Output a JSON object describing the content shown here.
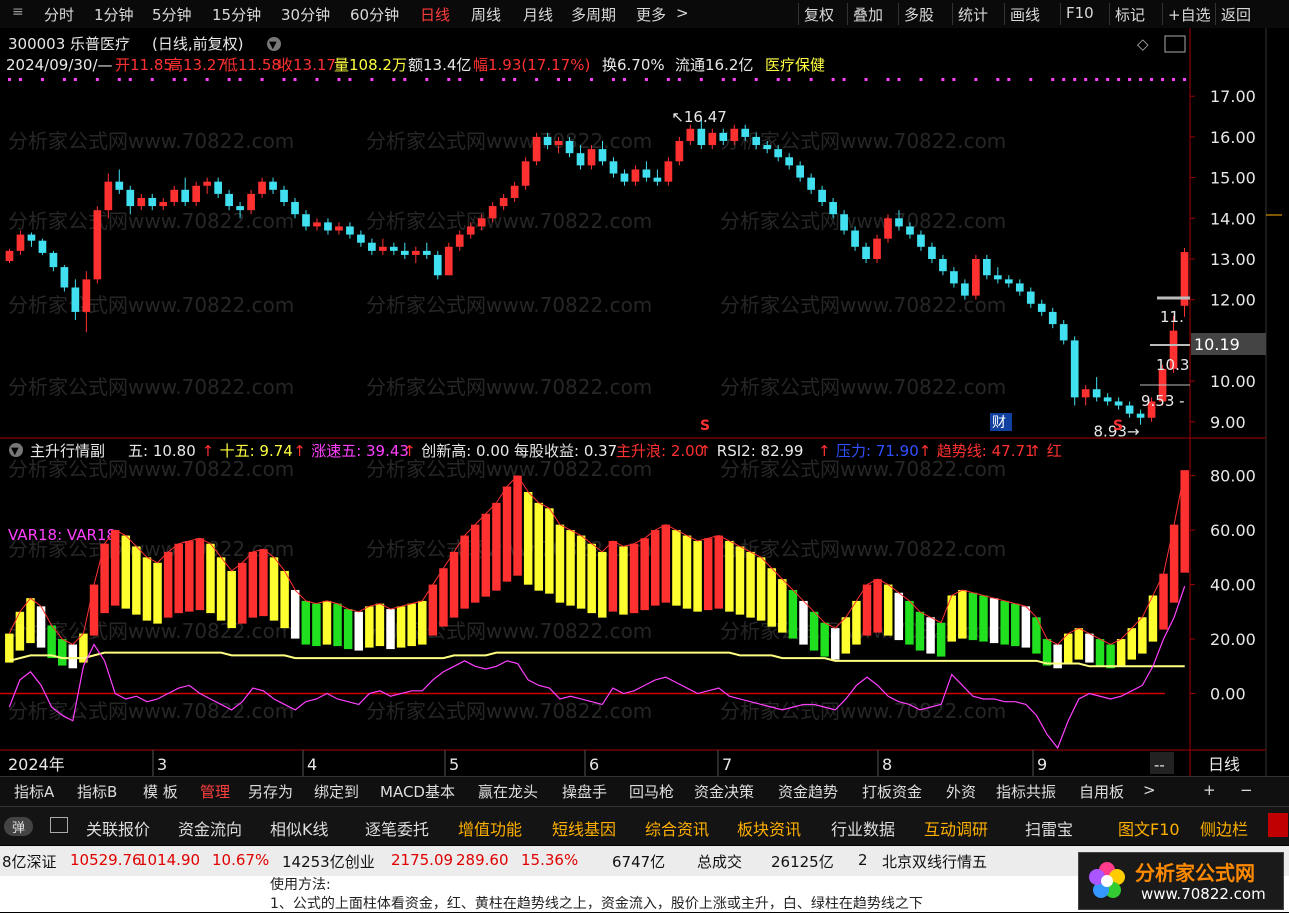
{
  "toolbar": {
    "periods": [
      "分时",
      "1分钟",
      "5分钟",
      "15分钟",
      "30分钟",
      "60分钟",
      "日线",
      "周线",
      "月线",
      "多周期",
      "更多"
    ],
    "active_period": "日线",
    "right_buttons": [
      "复权",
      "叠加",
      "多股",
      "统计",
      "画线",
      "F10",
      "标记",
      "+自选",
      "返回"
    ]
  },
  "stock": {
    "code_name": "300003 乐普医疗",
    "period_tag": "(日线,前复权)",
    "date": "2024/09/30/—",
    "open": "开11.85",
    "high": "高13.27",
    "low": "低11.58",
    "close": "收13.17",
    "volume": "量108.2万",
    "amount": "额13.4亿",
    "change": "幅1.93(17.17%)",
    "turnover": "换6.70%",
    "float_cap": "流通16.2亿",
    "sector": "医疗保健"
  },
  "watermark": "分析家公式网www.70822.com",
  "price_axis": [
    "17.00",
    "16.00",
    "15.00",
    "14.00",
    "13.00",
    "12.00",
    "11.00",
    "10.00",
    "9.00"
  ],
  "price_tags": {
    "last": "10.19",
    "box1": "11.",
    "box2": "10.3",
    "box3": "9.53 -"
  },
  "annotations": {
    "high": "16.47",
    "low": "8.93",
    "cai": "财",
    "s": "S"
  },
  "indicator": {
    "name": "主升行情副",
    "items": [
      {
        "label": "五: 10.80",
        "arrow": "↑",
        "color": "#e8e8e8"
      },
      {
        "label": "十五: 9.74",
        "arrow": "↑",
        "color": "#ffff40"
      },
      {
        "label": "涨速五: 39.43",
        "arrow": "↑",
        "color": "#ff40ff"
      },
      {
        "label": "创新高: 0.00",
        "arrow": "",
        "color": "#e8e8e8"
      },
      {
        "label": "每股收益: 0.37",
        "arrow": "",
        "color": "#e8e8e8"
      },
      {
        "label": "主升浪: 2.00",
        "arrow": "↑",
        "color": "#ff3030"
      },
      {
        "label": "RSI2: 82.99",
        "arrow": "↑",
        "color": "#e8e8e8"
      },
      {
        "label": "压力: 71.90",
        "arrow": "↑",
        "color": "#3050ff"
      },
      {
        "label": "趋势线: 47.71",
        "arrow": "↑",
        "color": "#ff3030"
      },
      {
        "label": "红",
        "arrow": "",
        "color": "#ff3030"
      }
    ],
    "var_label": "VAR18: VAR18"
  },
  "ind_axis": [
    "80.00",
    "60.00",
    "40.00",
    "20.00",
    "0.00"
  ],
  "xaxis": {
    "year": "2024年",
    "months": [
      "3",
      "4",
      "5",
      "6",
      "7",
      "8",
      "9"
    ],
    "period": "日线",
    "dash": "--"
  },
  "bottom_tabs": [
    "指标A",
    "指标B",
    "模 板",
    "管理",
    "另存为",
    "绑定到",
    "MACD基本",
    "赢在龙头",
    "操盘手",
    "回马枪",
    "资金决策",
    "资金趋势",
    "打板资金",
    "外资",
    "指标共振",
    "自用板"
  ],
  "bottom_tab_selected": "管理",
  "bottom_controls": {
    "more": ">",
    "plus": "+",
    "minus": "−"
  },
  "func_buttons": [
    {
      "label": "关联报价",
      "style": "normal"
    },
    {
      "label": "资金流向",
      "style": "normal"
    },
    {
      "label": "相似K线",
      "style": "normal"
    },
    {
      "label": "逐笔委托",
      "style": "normal"
    },
    {
      "label": "增值功能",
      "style": "orange"
    },
    {
      "label": "短线基因",
      "style": "orange"
    },
    {
      "label": "综合资讯",
      "style": "orange"
    },
    {
      "label": "板块资讯",
      "style": "orange"
    },
    {
      "label": "行业数据",
      "style": "normal"
    },
    {
      "label": "互动调研",
      "style": "orange"
    },
    {
      "label": "扫雷宝",
      "style": "normal"
    },
    {
      "label": "图文F10",
      "style": "orange"
    },
    {
      "label": "侧边栏",
      "style": "orange"
    }
  ],
  "pop_label": "弹",
  "ticker": [
    {
      "text": "8亿深证",
      "style": "normal"
    },
    {
      "text": "10529.76",
      "style": "red"
    },
    {
      "text": "1014.90",
      "style": "red"
    },
    {
      "text": "10.67%",
      "style": "red"
    },
    {
      "text": "14253亿创业",
      "style": "normal"
    },
    {
      "text": "2175.09",
      "style": "red"
    },
    {
      "text": "289.60",
      "style": "red"
    },
    {
      "text": "15.36%",
      "style": "red"
    },
    {
      "text": "6747亿",
      "style": "normal"
    },
    {
      "text": "总成交",
      "style": "normal"
    },
    {
      "text": "26125亿",
      "style": "normal"
    },
    {
      "text": "2",
      "style": "normal"
    },
    {
      "text": "北京双线行情五",
      "style": "normal"
    }
  ],
  "note_lines": [
    "使用方法:",
    "1、公式的上面柱体看资金，红、黄柱在趋势线之上，资金流入，股价上涨或主升，白、绿柱在趋势线之下"
  ],
  "logo": {
    "title": "分析家公式网",
    "url": "www.70822.com"
  },
  "colors": {
    "up": "#ff3030",
    "down": "#40e0f0",
    "yellow": "#ffff30",
    "green": "#20e020",
    "magenta": "#ff40ff",
    "axis": "#a00000"
  },
  "chart_data": [
    {
      "type": "candlestick",
      "title": "300003 乐普医疗 (日线,前复权)",
      "x_labels": [
        "2024年",
        "3",
        "4",
        "5",
        "6",
        "7",
        "8",
        "9"
      ],
      "ylim": [
        8.7,
        17.3
      ],
      "candles": [
        [
          12.95,
          13.25,
          12.9,
          13.2
        ],
        [
          13.2,
          13.7,
          13.1,
          13.6
        ],
        [
          13.6,
          13.65,
          13.3,
          13.45
        ],
        [
          13.45,
          13.5,
          13.1,
          13.15
        ],
        [
          13.15,
          13.2,
          12.7,
          12.8
        ],
        [
          12.8,
          12.85,
          12.2,
          12.3
        ],
        [
          12.3,
          12.5,
          11.5,
          11.7
        ],
        [
          11.7,
          12.7,
          11.2,
          12.5
        ],
        [
          12.5,
          14.3,
          12.4,
          14.2
        ],
        [
          14.2,
          15.1,
          14.0,
          14.9
        ],
        [
          14.9,
          15.2,
          14.6,
          14.7
        ],
        [
          14.7,
          14.8,
          14.1,
          14.3
        ],
        [
          14.3,
          14.6,
          14.2,
          14.5
        ],
        [
          14.5,
          14.6,
          14.2,
          14.3
        ],
        [
          14.3,
          14.5,
          14.2,
          14.4
        ],
        [
          14.4,
          14.8,
          14.3,
          14.7
        ],
        [
          14.7,
          15.0,
          14.3,
          14.4
        ],
        [
          14.4,
          14.9,
          14.3,
          14.8
        ],
        [
          14.8,
          15.0,
          14.6,
          14.9
        ],
        [
          14.9,
          15.0,
          14.5,
          14.6
        ],
        [
          14.6,
          14.7,
          14.2,
          14.3
        ],
        [
          14.3,
          14.4,
          14.0,
          14.2
        ],
        [
          14.2,
          14.7,
          14.1,
          14.6
        ],
        [
          14.6,
          15.0,
          14.5,
          14.9
        ],
        [
          14.9,
          15.0,
          14.6,
          14.7
        ],
        [
          14.7,
          14.8,
          14.3,
          14.4
        ],
        [
          14.4,
          14.5,
          14.0,
          14.1
        ],
        [
          14.1,
          14.2,
          13.7,
          13.8
        ],
        [
          13.8,
          14.0,
          13.7,
          13.9
        ],
        [
          13.9,
          14.0,
          13.6,
          13.7
        ],
        [
          13.7,
          13.9,
          13.6,
          13.8
        ],
        [
          13.8,
          13.9,
          13.5,
          13.6
        ],
        [
          13.6,
          13.7,
          13.3,
          13.4
        ],
        [
          13.4,
          13.5,
          13.1,
          13.2
        ],
        [
          13.2,
          13.5,
          13.1,
          13.3
        ],
        [
          13.3,
          13.4,
          13.1,
          13.2
        ],
        [
          13.2,
          13.4,
          13.0,
          13.1
        ],
        [
          13.1,
          13.3,
          12.9,
          13.2
        ],
        [
          13.2,
          13.4,
          13.0,
          13.1
        ],
        [
          13.1,
          13.2,
          12.5,
          12.6
        ],
        [
          12.6,
          13.4,
          12.6,
          13.3
        ],
        [
          13.3,
          13.7,
          13.2,
          13.6
        ],
        [
          13.6,
          13.9,
          13.5,
          13.8
        ],
        [
          13.8,
          14.1,
          13.7,
          14.0
        ],
        [
          14.0,
          14.4,
          13.9,
          14.3
        ],
        [
          14.3,
          14.6,
          14.2,
          14.5
        ],
        [
          14.5,
          14.9,
          14.4,
          14.8
        ],
        [
          14.8,
          15.5,
          14.7,
          15.4
        ],
        [
          15.4,
          16.1,
          15.3,
          16.0
        ],
        [
          16.0,
          16.1,
          15.7,
          15.8
        ],
        [
          15.8,
          16.0,
          15.6,
          15.9
        ],
        [
          15.9,
          16.0,
          15.5,
          15.6
        ],
        [
          15.6,
          15.8,
          15.2,
          15.3
        ],
        [
          15.3,
          15.8,
          15.2,
          15.7
        ],
        [
          15.7,
          15.9,
          15.3,
          15.4
        ],
        [
          15.4,
          15.5,
          15.0,
          15.1
        ],
        [
          15.1,
          15.2,
          14.8,
          14.9
        ],
        [
          14.9,
          15.3,
          14.8,
          15.2
        ],
        [
          15.2,
          15.4,
          14.9,
          15.0
        ],
        [
          15.0,
          15.2,
          14.8,
          14.9
        ],
        [
          14.9,
          15.5,
          14.8,
          15.4
        ],
        [
          15.4,
          16.0,
          15.3,
          15.9
        ],
        [
          15.9,
          16.3,
          15.8,
          16.2
        ],
        [
          16.2,
          16.47,
          15.7,
          15.8
        ],
        [
          15.8,
          16.2,
          15.7,
          16.1
        ],
        [
          16.1,
          16.2,
          15.8,
          15.9
        ],
        [
          15.9,
          16.3,
          15.8,
          16.2
        ],
        [
          16.2,
          16.3,
          15.9,
          16.0
        ],
        [
          16.0,
          16.1,
          15.7,
          15.8
        ],
        [
          15.8,
          15.9,
          15.6,
          15.7
        ],
        [
          15.7,
          15.8,
          15.4,
          15.5
        ],
        [
          15.5,
          15.6,
          15.2,
          15.3
        ],
        [
          15.3,
          15.4,
          14.9,
          15.0
        ],
        [
          15.0,
          15.1,
          14.6,
          14.7
        ],
        [
          14.7,
          14.8,
          14.3,
          14.4
        ],
        [
          14.4,
          14.5,
          14.0,
          14.1
        ],
        [
          14.1,
          14.2,
          13.6,
          13.7
        ],
        [
          13.7,
          13.8,
          13.2,
          13.3
        ],
        [
          13.3,
          13.4,
          12.9,
          13.0
        ],
        [
          13.0,
          13.6,
          12.9,
          13.5
        ],
        [
          13.5,
          14.1,
          13.4,
          14.0
        ],
        [
          14.0,
          14.2,
          13.7,
          13.8
        ],
        [
          13.8,
          13.9,
          13.5,
          13.6
        ],
        [
          13.6,
          13.7,
          13.2,
          13.3
        ],
        [
          13.3,
          13.4,
          12.9,
          13.0
        ],
        [
          13.0,
          13.1,
          12.6,
          12.7
        ],
        [
          12.7,
          12.8,
          12.3,
          12.4
        ],
        [
          12.4,
          12.5,
          12.0,
          12.1
        ],
        [
          12.1,
          13.1,
          12.0,
          13.0
        ],
        [
          13.0,
          13.1,
          12.5,
          12.6
        ],
        [
          12.6,
          12.8,
          12.4,
          12.5
        ],
        [
          12.5,
          12.6,
          12.3,
          12.4
        ],
        [
          12.4,
          12.5,
          12.1,
          12.2
        ],
        [
          12.2,
          12.3,
          11.8,
          11.9
        ],
        [
          11.9,
          12.0,
          11.6,
          11.7
        ],
        [
          11.7,
          11.8,
          11.3,
          11.4
        ],
        [
          11.4,
          11.5,
          10.9,
          11.0
        ],
        [
          11.0,
          11.1,
          9.4,
          9.6
        ],
        [
          9.6,
          9.9,
          9.4,
          9.8
        ],
        [
          9.8,
          10.1,
          9.5,
          9.6
        ],
        [
          9.6,
          9.7,
          9.4,
          9.5
        ],
        [
          9.5,
          9.6,
          9.3,
          9.4
        ],
        [
          9.4,
          9.5,
          9.1,
          9.2
        ],
        [
          9.2,
          9.3,
          8.93,
          9.1
        ],
        [
          9.1,
          9.6,
          9.0,
          9.5
        ],
        [
          9.5,
          10.4,
          9.4,
          10.3
        ],
        [
          10.3,
          11.6,
          10.2,
          11.24
        ],
        [
          11.85,
          13.27,
          11.58,
          13.17
        ]
      ]
    },
    {
      "type": "bar",
      "title": "主升行情副",
      "ylim": [
        -20,
        85
      ],
      "series": [
        {
          "name": "五",
          "values": [
            22,
            30,
            35,
            32,
            25,
            20,
            18,
            22,
            40,
            55,
            60,
            58,
            54,
            50,
            48,
            52,
            55,
            56,
            57,
            55,
            50,
            45,
            48,
            52,
            53,
            50,
            45,
            38,
            34,
            33,
            34,
            33,
            31,
            30,
            32,
            33,
            31,
            32,
            33,
            34,
            40,
            46,
            52,
            58,
            62,
            66,
            70,
            76,
            80,
            74,
            70,
            68,
            62,
            60,
            58,
            55,
            52,
            56,
            54,
            55,
            57,
            60,
            62,
            60,
            58,
            56,
            57,
            58,
            56,
            54,
            52,
            50,
            46,
            42,
            38,
            34,
            30,
            26,
            24,
            28,
            34,
            40,
            42,
            40,
            37,
            34,
            30,
            28,
            26,
            36,
            38,
            37,
            36,
            35,
            34,
            33,
            32,
            28,
            20,
            18,
            22,
            24,
            22,
            20,
            18,
            20,
            24,
            28,
            36,
            44,
            62,
            82
          ]
        },
        {
          "name": "十五",
          "values": [
            12,
            13,
            14,
            14,
            14,
            13,
            13,
            13,
            14,
            15,
            15,
            15,
            15,
            15,
            15,
            15,
            15,
            15,
            15,
            15,
            15,
            14,
            14,
            14,
            14,
            14,
            14,
            13,
            13,
            13,
            13,
            13,
            13,
            13,
            13,
            13,
            13,
            13,
            13,
            13,
            13,
            13,
            14,
            14,
            14,
            14,
            15,
            15,
            15,
            15,
            15,
            15,
            15,
            15,
            15,
            15,
            15,
            15,
            15,
            15,
            15,
            15,
            15,
            15,
            15,
            15,
            15,
            15,
            15,
            14,
            14,
            14,
            14,
            13,
            13,
            13,
            13,
            13,
            12,
            12,
            12,
            12,
            12,
            12,
            12,
            12,
            12,
            12,
            12,
            12,
            12,
            12,
            12,
            12,
            12,
            12,
            12,
            12,
            11,
            11,
            11,
            11,
            10,
            10,
            10,
            10,
            10,
            10,
            10,
            10,
            10,
            10
          ]
        },
        {
          "name": "涨速五",
          "values": [
            -5,
            5,
            8,
            3,
            -5,
            -8,
            -10,
            10,
            18,
            12,
            0,
            -2,
            -1,
            -3,
            -2,
            0,
            2,
            3,
            0,
            -2,
            -4,
            -6,
            -3,
            2,
            1,
            -2,
            -4,
            -6,
            -3,
            -2,
            0,
            -2,
            -3,
            -4,
            0,
            1,
            -1,
            0,
            1,
            1,
            5,
            8,
            10,
            12,
            10,
            9,
            10,
            12,
            11,
            5,
            3,
            2,
            -2,
            -1,
            -2,
            -3,
            -4,
            2,
            0,
            1,
            3,
            5,
            6,
            4,
            2,
            0,
            1,
            2,
            -1,
            -2,
            -3,
            -4,
            -5,
            -6,
            -5,
            -4,
            -4,
            -5,
            -6,
            -2,
            3,
            6,
            3,
            -1,
            -3,
            -4,
            -6,
            -5,
            -4,
            7,
            3,
            -1,
            -2,
            -2,
            -3,
            -3,
            -4,
            -8,
            -15,
            -20,
            -10,
            -2,
            0,
            -1,
            -2,
            -1,
            1,
            3,
            10,
            20,
            28,
            39.43
          ]
        }
      ]
    }
  ]
}
